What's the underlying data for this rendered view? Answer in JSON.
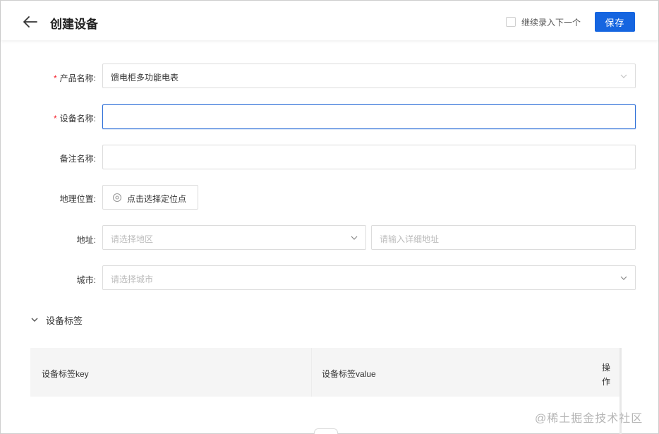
{
  "header": {
    "title": "创建设备",
    "continue_label": "继续录入下一个",
    "save_label": "保存"
  },
  "form": {
    "product": {
      "label": "产品名称:",
      "value": "馈电柜多功能电表"
    },
    "device_name": {
      "label": "设备名称:",
      "value": ""
    },
    "remark": {
      "label": "备注名称:",
      "value": ""
    },
    "location": {
      "label": "地理位置:",
      "button_label": "点击选择定位点"
    },
    "address": {
      "label": "地址:",
      "region_placeholder": "请选择地区",
      "detail_placeholder": "请输入详细地址"
    },
    "city": {
      "label": "城市:",
      "placeholder": "请选择城市"
    }
  },
  "tags_section": {
    "title": "设备标签",
    "columns": [
      "设备标签key",
      "设备标签value",
      "操作"
    ]
  },
  "watermark": "@稀土掘金技术社区",
  "colors": {
    "primary": "#1565e0",
    "required": "#f5222d",
    "focus_border": "#2e6fd8",
    "table_header_bg": "#f5f5f5"
  },
  "icons": [
    "back-arrow-icon",
    "chevron-down-icon",
    "location-pin-icon"
  ]
}
